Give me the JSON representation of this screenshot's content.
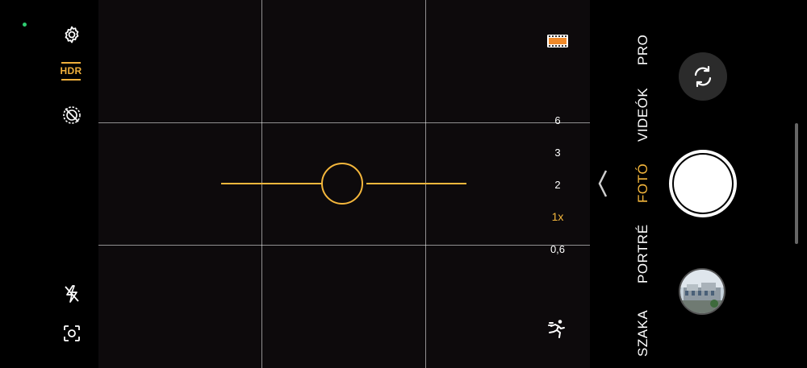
{
  "left_toolbar": {
    "settings_icon": "gear-icon",
    "hdr_label": "HDR",
    "ai_icon": "ai-scene-off-icon",
    "flash_icon": "flash-off-icon",
    "lens_icon": "focus-scan-icon",
    "status_dot_color": "#2ecc71"
  },
  "viewfinder": {
    "film_icon": "film-filter-icon",
    "zoom_levels": [
      "6",
      "3",
      "2",
      "1x",
      "0,6"
    ],
    "active_zoom": "1x",
    "motion_icon": "running-person-icon",
    "accent_color": "#f5b73c"
  },
  "modes": {
    "items": [
      "SZAKA",
      "PORTRÉ",
      "FOTÓ",
      "VIDEÓK",
      "PRO"
    ],
    "active": "FOTÓ"
  },
  "controls": {
    "flip_camera_icon": "camera-flip-icon",
    "shutter_icon": "shutter-button",
    "gallery_thumbnail": "gallery-thumbnail",
    "collapse_icon": "chevron-left-icon"
  }
}
